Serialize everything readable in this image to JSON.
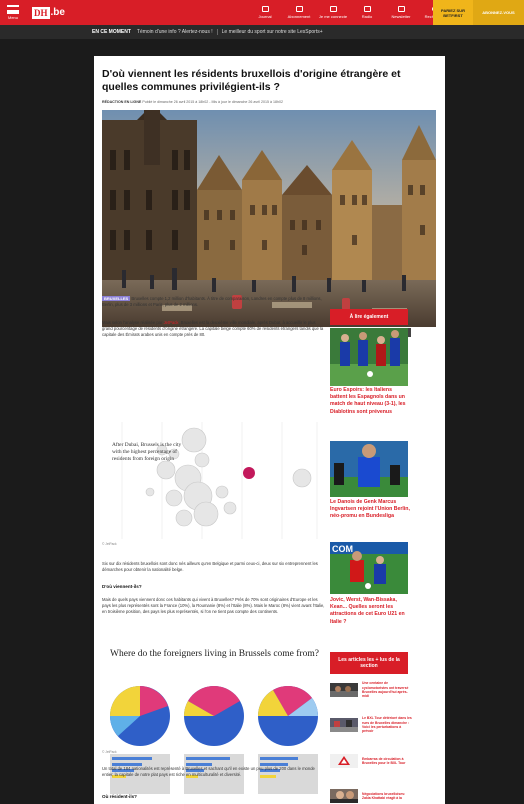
{
  "header": {
    "menu_label": "Menu",
    "logo_dh": "DH",
    "logo_be": ".be",
    "nav": [
      {
        "label": "Journal"
      },
      {
        "label": "Abonnement"
      },
      {
        "label": "Je me connecte"
      },
      {
        "label": "Radio"
      },
      {
        "label": "Newsletter"
      },
      {
        "label": "Rechercher"
      }
    ],
    "cta_primary": "PARIEZ SUR BETFIRST",
    "cta_secondary": "ABONNEZ-VOUS"
  },
  "ticker": {
    "label": "EN CE MOMENT",
    "items": [
      "Témoin d'une info ? Alertez-nous !",
      "Le meilleur du sport sur notre site LesSports+"
    ]
  },
  "article": {
    "title": "D'où viennent les résidents bruxellois d'origine étrangère et quelles communes privilégient-ils ?",
    "author": "RÉDACTION EN LIGNE",
    "dates": "Publié le dimanche 26 avril 2015 à 18h02 - Mis à jour le dimanche 26 avril 2015 à 18h02",
    "tag": "BRUXELLES",
    "p1": "Bruxelles compte 1,2 million d'habitants. À titre de comparaison, Londres en compte plus de 8 millions, Berlin, plus de 3 millions et Paris, plus de 2 millions.",
    "p2_pre": "Mais selon l'analyse réalisée par ",
    "p2_link": "JetPack",
    "p2_post": ", Bruxelles est la deuxième ville mondiale, après Dubaï, à accueillir le plus grand pourcentage de résidents d'origine étrangère. La capitale belge compte 60% de résidents étrangers tandis que la capitale des Émirats arabes unis en compte près de 80.",
    "bubble_note": "After Dubai, Brussels is the city with the highest percentage of residents from foreign origin",
    "src1": "© JetPack",
    "p3": "Six sur dix résidents bruxellois sont donc nés ailleurs qu'en Belgique et parmi ceux-ci, deux sur six entreprennent les démarches pour obtenir la nationalité belge.",
    "h1": "D'où viennent-ils?",
    "p4": "Mais de quels pays viennent donc ces habitants qui vivent à Bruxelles? Près de 70% sont originaires d'Europe et les pays les plus représentés sont la France (10%), la Roumanie (8%) et l'Italie (8%). Mais le Maroc (8%) vient avant l'Italie, en troisième position, des pays les plus représentés, si l'on ne tient pas compte des continents.",
    "pie_title": "Where do the foreigners living in Brussels come from?",
    "src2": "© JetPack",
    "p5": "Un total de 184 nationalités est représenté à Bruxelles et sachant qu'il en existe un peu plus de 200 dans le monde entier, la capitale de notre plat pays est riche en multiculturalité et diversité.",
    "h2": "Où résident-ils?"
  },
  "sidebar": {
    "head1": "À lire également",
    "stories": [
      {
        "title": "Euro Espoirs: les Italiens battent les Espagnols dans un match de haut niveau (3-1), les Diablotins sont prévenus"
      },
      {
        "title": "Le Danois de Genk Marcus Ingvartsen rejoint l'Union Berlin, néo-promu en Bundesliga"
      },
      {
        "title": "Jovic, Werst, Wan-Bissaka, Kean... Quelles seront les attractions de cet Euro U21 en Italie ?"
      }
    ],
    "head2": "Les articles les + lus de la section",
    "mini": [
      {
        "title": "Une centaine de cyclomotoristes ont traversé Bruxelles aujourd'hui après-midi"
      },
      {
        "title": "Le BXL Tour détérioré dans les rues de Bruxelles dimanche : Voici les perturbations à prévoir"
      },
      {
        "title": "Embarras de circulation à Bruxelles pour le BXL Tour"
      },
      {
        "title": "Négociations bruxelloises: Zakia Khattabi réagit à la"
      }
    ]
  },
  "share_colors": [
    "#25d366",
    "#3b5998",
    "#1da1f2",
    "#0077b5",
    "#555555",
    "#888888",
    "#e7473c",
    "#444444"
  ],
  "colors": {
    "accent": "#d81e27",
    "gold": "#f0b51a"
  }
}
